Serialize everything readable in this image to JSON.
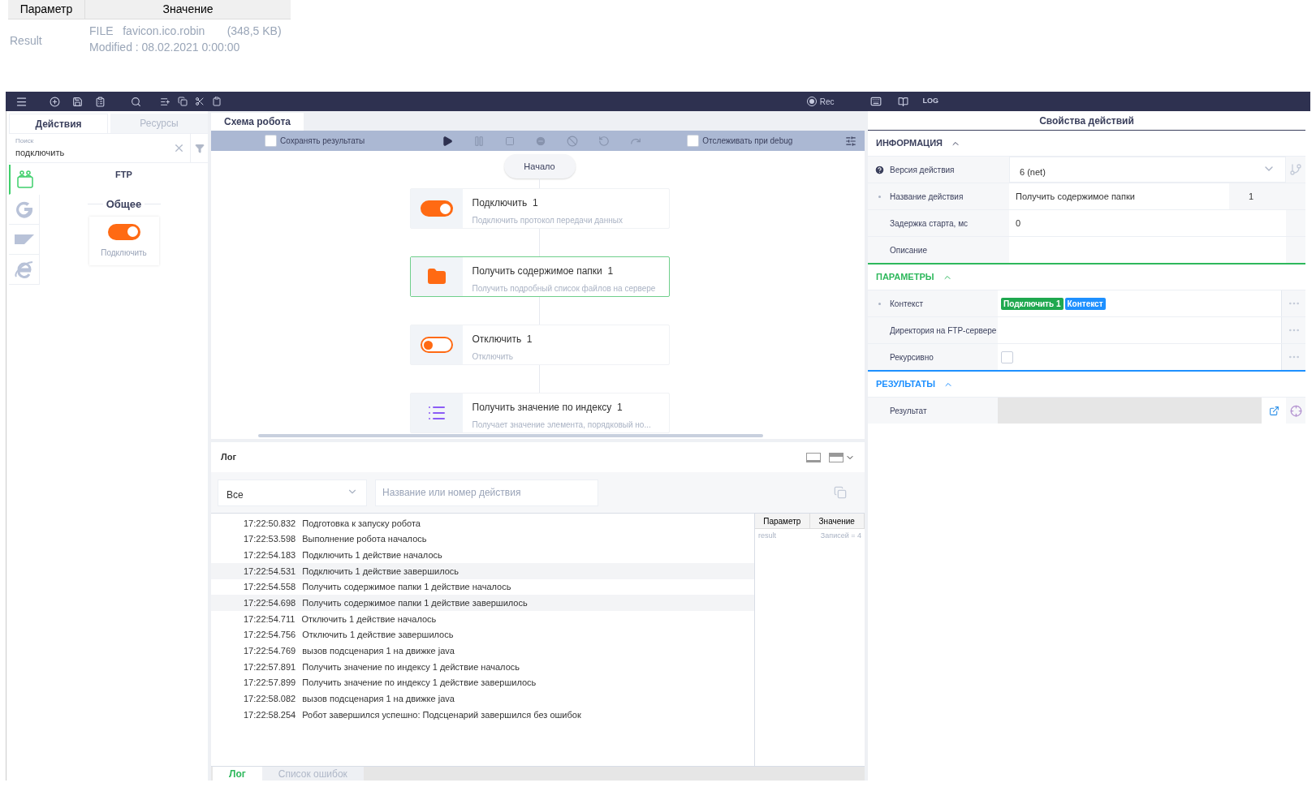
{
  "top_table": {
    "columns": [
      "Параметр",
      "Значение"
    ],
    "row": {
      "name": "Result",
      "lines": [
        "FILE   favicon.ico.robin       (348,5 KB)",
        "Modified : 08.02.2021 0:00:00"
      ]
    }
  },
  "toolbar": {
    "rec": "Rec",
    "log": "LOG"
  },
  "left": {
    "tabs": [
      {
        "label": "Действия",
        "selected": true
      },
      {
        "label": "Ресурсы",
        "selected": false
      }
    ],
    "search": {
      "label": "Поиск",
      "value": "подключить"
    },
    "categories": [
      {
        "kind": "ftp",
        "selected": true
      },
      {
        "kind": "google",
        "selected": false
      },
      {
        "kind": "sap",
        "selected": false
      },
      {
        "kind": "ie",
        "selected": false
      }
    ],
    "group_title": "FTP",
    "section": "Общее",
    "actions": [
      {
        "kind": "toggle_on",
        "label": "Подключить"
      }
    ]
  },
  "center": {
    "tab": "Схема робота",
    "controls": {
      "save_results": {
        "label": "Сохранять результаты",
        "checked": false
      },
      "debug": {
        "label": "Отслеживать при debug",
        "checked": false
      }
    },
    "start": "Начало",
    "nodes": [
      {
        "kind": "toggle_on",
        "title": "Подключить  1",
        "desc": "Подключить протокол передачи данных",
        "selected": false
      },
      {
        "kind": "folder",
        "title": "Получить содержимое папки  1",
        "desc": "Получить подробный список файлов на сервере",
        "selected": true
      },
      {
        "kind": "toggle_off",
        "title": "Отключить  1",
        "desc": "Отключить",
        "selected": false
      },
      {
        "kind": "list",
        "title": "Получить значение по индексу  1",
        "desc": "Получает значение элемента, порядковый но...",
        "selected": false
      }
    ]
  },
  "log": {
    "title": "Лог",
    "filter": "Все",
    "search_placeholder": "Название или номер действия",
    "rows": [
      {
        "time": "17:22:50.832",
        "text": "Подготовка к запуску робота",
        "selected": false
      },
      {
        "time": "17:22:53.598",
        "text": "Выполнение робота началось",
        "selected": false
      },
      {
        "time": "17:22:54.183",
        "text": "Подключить 1 действие началось",
        "selected": false
      },
      {
        "time": "17:22:54.531",
        "text": "Подключить 1 действие завершилось",
        "selected": true
      },
      {
        "time": "17:22:54.558",
        "text": "Получить содержимое папки 1 действие началось",
        "selected": false
      },
      {
        "time": "17:22:54.698",
        "text": "Получить содержимое папки 1 действие завершилось",
        "selected": true
      },
      {
        "time": "17:22:54.711",
        "text": "Отключить 1 действие началось",
        "selected": false
      },
      {
        "time": "17:22:54.756",
        "text": "Отключить 1 действие завершилось",
        "selected": false
      },
      {
        "time": "17:22:54.769",
        "text": "вызов подсценария 1 на движке java",
        "selected": false
      },
      {
        "time": "17:22:57.891",
        "text": "Получить значение по индексу 1 действие началось",
        "selected": false
      },
      {
        "time": "17:22:57.899",
        "text": "Получить значение по индексу 1 действие завершилось",
        "selected": false
      },
      {
        "time": "17:22:58.082",
        "text": "вызов подсценария 1 на движке java",
        "selected": false
      },
      {
        "time": "17:22:58.254",
        "text": "Робот завершился успешно: Подсценарий завершился без ошибок",
        "selected": false
      }
    ],
    "vars": {
      "columns": [
        "Параметр",
        "Значение"
      ],
      "row": {
        "name": "result",
        "value": "Записей = 4"
      }
    },
    "tabs": [
      {
        "label": "Лог",
        "selected": true
      },
      {
        "label": "Список ошибок",
        "selected": false
      }
    ]
  },
  "right": {
    "title": "Свойства действий",
    "sections": [
      {
        "title": "ИНФОРМАЦИЯ",
        "color": "#3a3f5c",
        "expanded": true,
        "rows": [
          {
            "kind": "select",
            "label": "Версия действия",
            "value": "6 (net)",
            "required": false,
            "help": true
          },
          {
            "kind": "name",
            "label": "Название действия",
            "value": "Получить содержимое папки",
            "suffix": "1",
            "required": true,
            "help": false
          },
          {
            "kind": "text",
            "label": "Задержка старта, мс",
            "value": "0",
            "required": false,
            "help": false
          },
          {
            "kind": "text",
            "label": "Описание",
            "required": false,
            "help": false
          }
        ]
      },
      {
        "title": "ПАРАМЕТРЫ",
        "color": "#2eb85c",
        "expanded": true,
        "rows": [
          {
            "kind": "tags",
            "label": "Контекст",
            "tags": [
              {
                "text": "Подключить 1",
                "color": "#1fa84f"
              },
              {
                "text": "Контекст",
                "color": "#1e90ff"
              }
            ],
            "required": true,
            "help": false
          },
          {
            "kind": "text_more",
            "label": "Директория на FTP-сервере",
            "required": false,
            "help": false
          },
          {
            "kind": "checkbox",
            "label": "Рекурсивно",
            "checked": false,
            "required": false,
            "help": false
          }
        ]
      },
      {
        "title": "РЕЗУЛЬТАТЫ",
        "color": "#1e90ff",
        "expanded": true,
        "rows": [
          {
            "kind": "result",
            "label": "Результат",
            "required": false,
            "help": false
          }
        ]
      }
    ]
  }
}
